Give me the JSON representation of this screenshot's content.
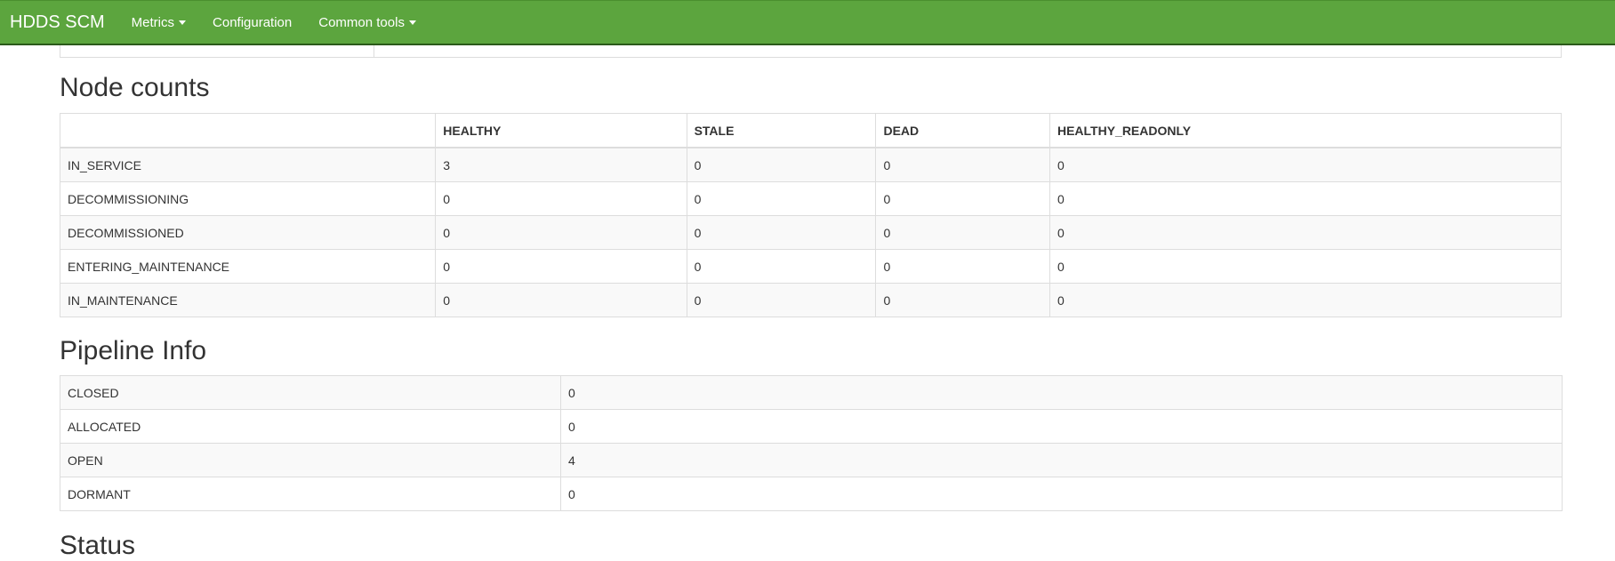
{
  "navbar": {
    "brand": "HDDS SCM",
    "items": [
      {
        "label": "Metrics",
        "dropdown": true
      },
      {
        "label": "Configuration",
        "dropdown": false
      },
      {
        "label": "Common tools",
        "dropdown": true
      }
    ]
  },
  "node_counts": {
    "title": "Node counts",
    "columns": [
      "",
      "HEALTHY",
      "STALE",
      "DEAD",
      "HEALTHY_READONLY"
    ],
    "rows": [
      [
        "IN_SERVICE",
        "3",
        "0",
        "0",
        "0"
      ],
      [
        "DECOMMISSIONING",
        "0",
        "0",
        "0",
        "0"
      ],
      [
        "DECOMMISSIONED",
        "0",
        "0",
        "0",
        "0"
      ],
      [
        "ENTERING_MAINTENANCE",
        "0",
        "0",
        "0",
        "0"
      ],
      [
        "IN_MAINTENANCE",
        "0",
        "0",
        "0",
        "0"
      ]
    ]
  },
  "pipeline_info": {
    "title": "Pipeline Info",
    "rows": [
      [
        "CLOSED",
        "0"
      ],
      [
        "ALLOCATED",
        "0"
      ],
      [
        "OPEN",
        "4"
      ],
      [
        "DORMANT",
        "0"
      ]
    ]
  },
  "status": {
    "title": "Status"
  },
  "colors": {
    "navbar": "#5ca53e",
    "border": "#dddddd",
    "stripe": "#f9f9f9"
  }
}
